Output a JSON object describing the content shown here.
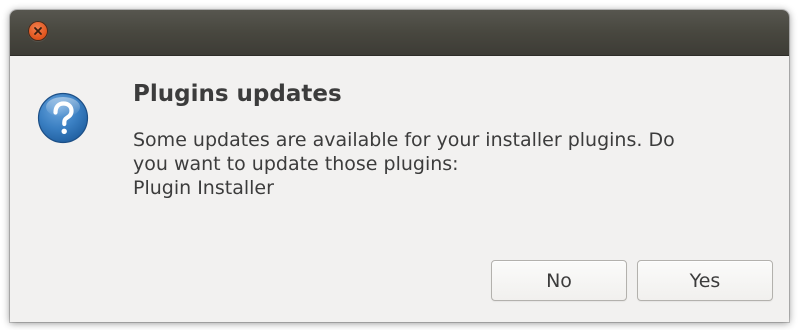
{
  "window": {
    "close_icon": "close-icon",
    "accent_close": "#e1561e",
    "titlebar_color": "#48473f"
  },
  "dialog": {
    "icon": "question-icon",
    "icon_color": "#2f6fae",
    "title": "Plugins updates",
    "message_lines": [
      "Some updates are available for your installer plugins. Do",
      "you want to update those plugins:",
      "Plugin Installer"
    ],
    "buttons": {
      "no": "No",
      "yes": "Yes"
    }
  }
}
